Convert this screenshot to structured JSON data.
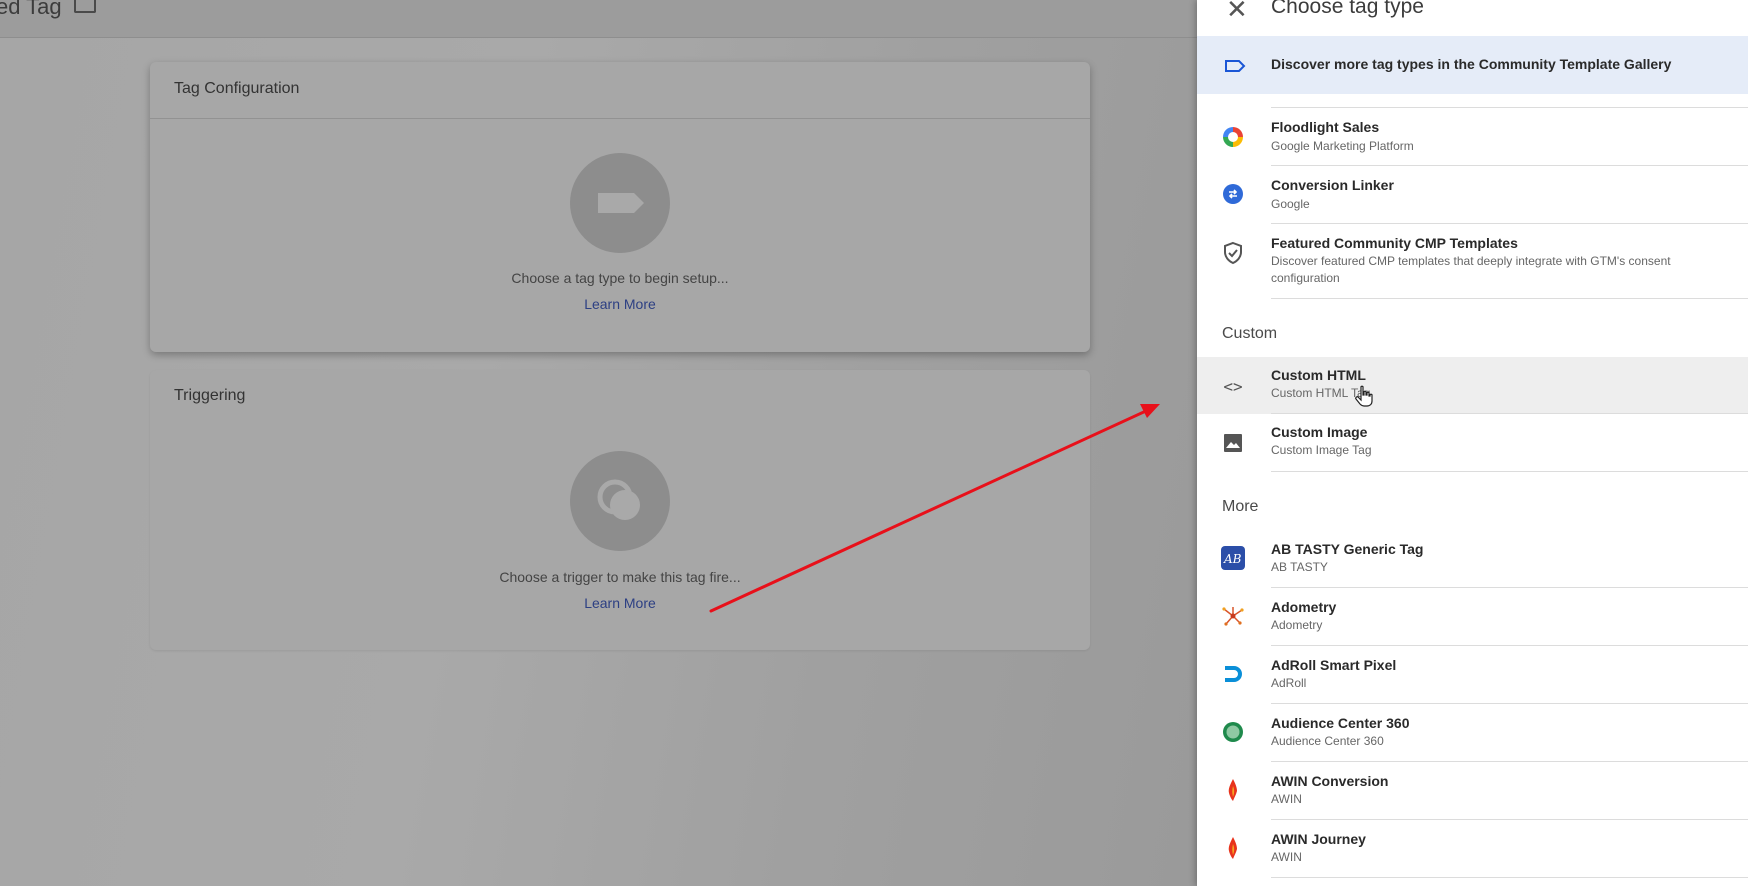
{
  "topbar": {
    "title": "ed Tag"
  },
  "config_card": {
    "title": "Tag Configuration",
    "hint": "Choose a tag type to begin setup...",
    "learn_more": "Learn More"
  },
  "trigger_card": {
    "title": "Triggering",
    "hint": "Choose a trigger to make this tag fire...",
    "learn_more": "Learn More"
  },
  "panel": {
    "title": "Choose tag type",
    "discover": "Discover more tag types in the Community Template Gallery",
    "featured": [
      {
        "name": "Floodlight Sales",
        "sub": "Google Marketing Platform",
        "icon": "floodlight-icon"
      },
      {
        "name": "Conversion Linker",
        "sub": "Google",
        "icon": "conversion-linker-icon"
      },
      {
        "name": "Featured Community CMP Templates",
        "sub": "Discover featured CMP templates that deeply integrate with GTM's consent configuration",
        "icon": "shield-check-icon"
      }
    ],
    "custom_label": "Custom",
    "custom": [
      {
        "name": "Custom HTML",
        "sub": "Custom HTML Tag",
        "icon": "code-icon"
      },
      {
        "name": "Custom Image",
        "sub": "Custom Image Tag",
        "icon": "image-icon"
      }
    ],
    "more_label": "More",
    "more": [
      {
        "name": "AB TASTY Generic Tag",
        "sub": "AB TASTY",
        "icon": "abtasty-icon"
      },
      {
        "name": "Adometry",
        "sub": "Adometry",
        "icon": "adometry-icon"
      },
      {
        "name": "AdRoll Smart Pixel",
        "sub": "AdRoll",
        "icon": "adroll-icon"
      },
      {
        "name": "Audience Center 360",
        "sub": "Audience Center 360",
        "icon": "audience-center-icon"
      },
      {
        "name": "AWIN Conversion",
        "sub": "AWIN",
        "icon": "awin-icon"
      },
      {
        "name": "AWIN Journey",
        "sub": "AWIN",
        "icon": "awin-icon"
      }
    ]
  },
  "colors": {
    "arrow": "#e8101a",
    "link": "#2c3f83",
    "discover_bg": "#e5ecf8"
  }
}
